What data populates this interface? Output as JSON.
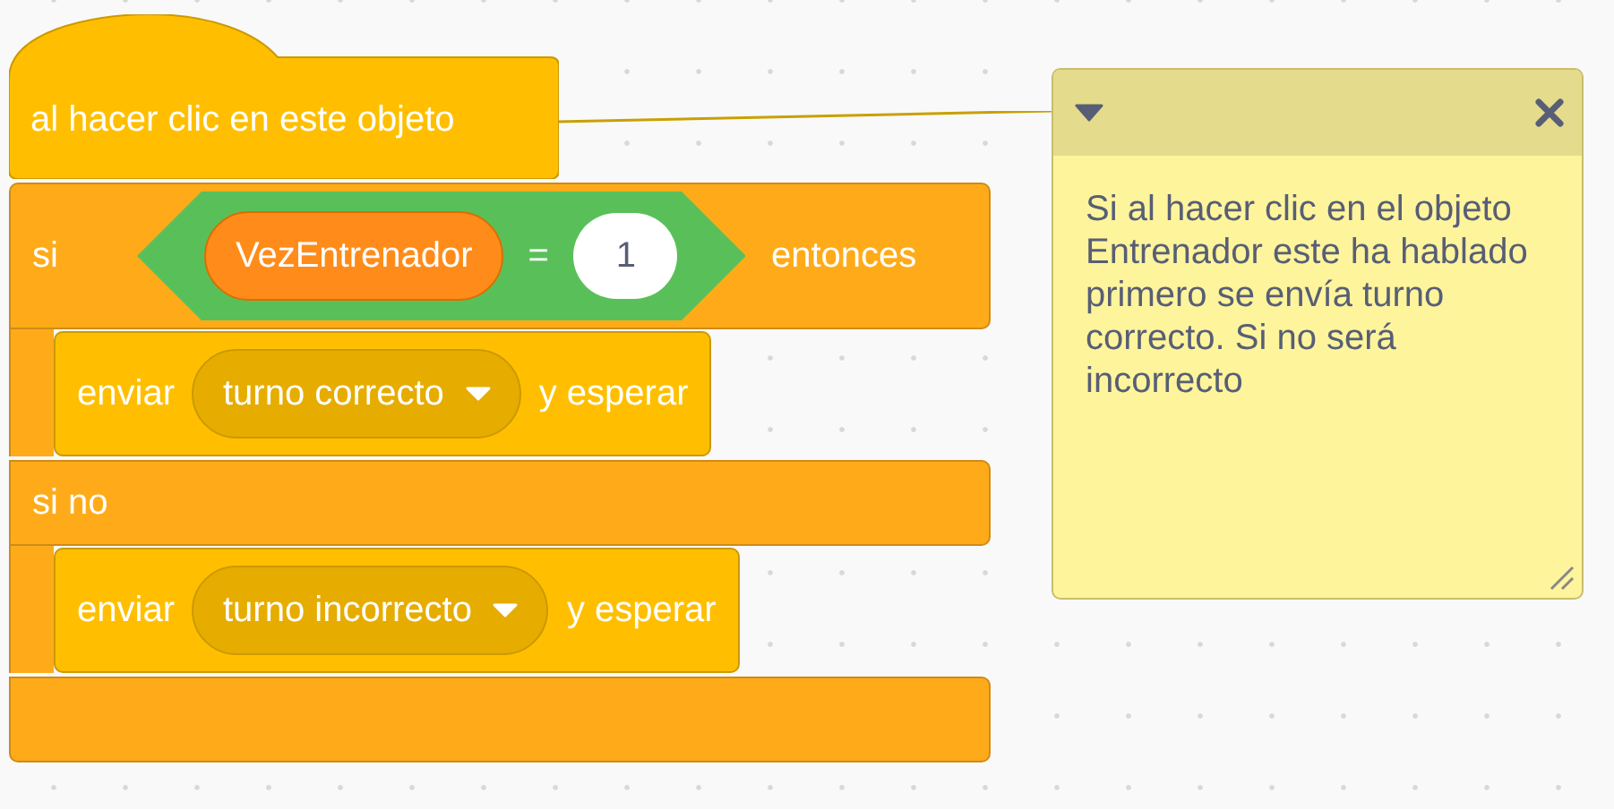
{
  "hat_block": {
    "label": "al hacer clic en este objeto"
  },
  "if_else_block": {
    "if_label": "si",
    "then_label": "entonces",
    "else_label": "si no",
    "condition": {
      "variable": "VezEntrenador",
      "operator": "=",
      "value": "1"
    },
    "then_blocks": [
      {
        "label": "enviar",
        "message": "turno correcto",
        "suffix": "y esperar"
      }
    ],
    "else_blocks": [
      {
        "label": "enviar",
        "message": "turno incorrecto",
        "suffix": "y esperar"
      }
    ]
  },
  "comment": {
    "text": "Si al hacer clic en el objeto Entrenador este ha hablado primero se envía turno correcto. Si no será incorrecto"
  }
}
